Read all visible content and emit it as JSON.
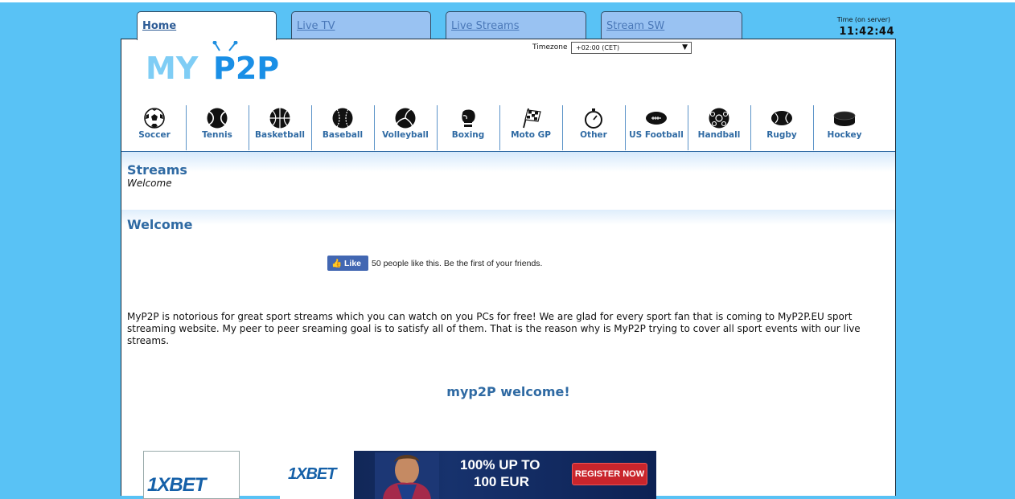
{
  "tabs": [
    {
      "label": "Home",
      "active": true
    },
    {
      "label": "Live TV",
      "active": false
    },
    {
      "label": "Live Streams",
      "active": false
    },
    {
      "label": "Stream SW",
      "active": false
    }
  ],
  "server_time": {
    "label": "Time (on server)",
    "value": "11:42:44"
  },
  "logo": {
    "text_a": "MY",
    "text_b": "P2P"
  },
  "timezone": {
    "label": "Timezone",
    "selected": "+02:00 (CET)"
  },
  "sports": [
    {
      "label": "Soccer",
      "icon": "soccer-ball-icon"
    },
    {
      "label": "Tennis",
      "icon": "tennis-ball-icon"
    },
    {
      "label": "Basketball",
      "icon": "basketball-icon"
    },
    {
      "label": "Baseball",
      "icon": "baseball-icon"
    },
    {
      "label": "Volleyball",
      "icon": "volleyball-icon"
    },
    {
      "label": "Boxing",
      "icon": "boxing-glove-icon"
    },
    {
      "label": "Moto GP",
      "icon": "checkered-flag-icon"
    },
    {
      "label": "Other",
      "icon": "stopwatch-icon"
    },
    {
      "label": "US Football",
      "icon": "american-football-icon"
    },
    {
      "label": "Handball",
      "icon": "handball-icon"
    },
    {
      "label": "Rugby",
      "icon": "rugby-ball-icon"
    },
    {
      "label": "Hockey",
      "icon": "hockey-puck-icon"
    }
  ],
  "streams": {
    "title": "Streams",
    "subtitle": "Welcome"
  },
  "main": {
    "heading": "Welcome",
    "like_button": "Like",
    "like_text": "50 people like this. Be the first of your friends.",
    "intro": "MyP2P is notorious for great sport streams which you can watch on you PCs for free! We are glad for every sport fan that is coming to MyP2P.EU sport streaming website. My peer to peer sreaming goal is to satisfy all of them. That is the reason why is MyP2P trying to cover all sport events with our live streams.",
    "center_heading": "myp2P welcome!"
  },
  "ads": {
    "small_brand": "1XBET",
    "banner_brand": "1XBET",
    "banner_offer_line1": "100% UP TO",
    "banner_offer_line2": "100 EUR",
    "banner_cta": "REGISTER NOW"
  },
  "colors": {
    "page_bg": "#59c2f5",
    "accent": "#2f6aa3",
    "tab_bg": "#99c2f2",
    "fb_blue": "#4267b2",
    "cta_red": "#c9252c"
  }
}
